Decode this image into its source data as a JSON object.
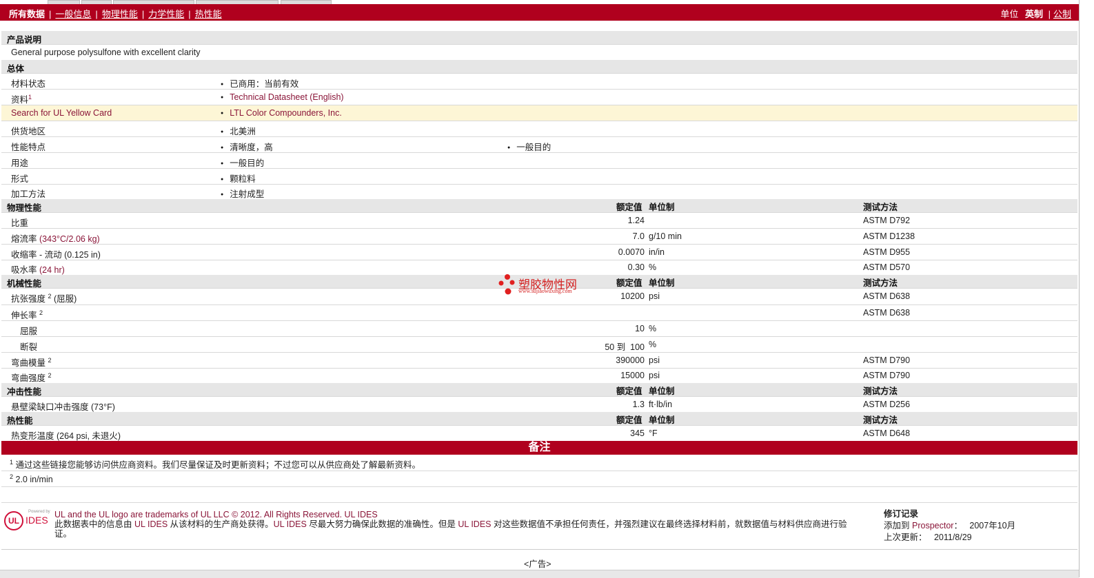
{
  "nav": {
    "tabs": [
      "所有数据",
      "一般信息",
      "物理性能",
      "力学性能",
      "热性能"
    ],
    "units_label": "单位",
    "unit_english": "英制",
    "unit_metric": "公制"
  },
  "product": {
    "header": "产品说明",
    "description": "General purpose polysulfone with excellent clarity"
  },
  "general": {
    "header": "总体",
    "rows": [
      {
        "label": "材料状态",
        "value": "已商用：当前有效"
      },
      {
        "label": "资料",
        "sup": "1",
        "value": "Technical Datasheet (English)"
      },
      {
        "label": "Search for UL Yellow Card",
        "value": "LTL Color Compounders, Inc."
      },
      {
        "label": "供货地区",
        "value": "北美洲"
      },
      {
        "label": "性能特点",
        "value": "清晰度，高",
        "value2": "一般目的"
      },
      {
        "label": "用途",
        "value": "一般目的"
      },
      {
        "label": "形式",
        "value": "颗粒料"
      },
      {
        "label": "加工方法",
        "value": "注射成型"
      }
    ]
  },
  "col_headers": {
    "rated": "额定值",
    "unit": "单位制",
    "method": "测试方法"
  },
  "physical": {
    "header": "物理性能",
    "rows": [
      {
        "label": "比重",
        "cond": "",
        "value": "1.24",
        "unit": "",
        "method": "ASTM D792"
      },
      {
        "label": "熔流率",
        "cond": "(343°C/2.06 kg)",
        "value": "7.0",
        "unit": "g/10 min",
        "method": "ASTM D1238"
      },
      {
        "label": "收缩率",
        "cond": "- 流动 (0.125 in)",
        "value": "0.0070",
        "unit": "in/in",
        "method": "ASTM D955"
      },
      {
        "label": "吸水率",
        "cond": "(24 hr)",
        "value": "0.30",
        "unit": "%",
        "method": "ASTM D570"
      }
    ]
  },
  "mechanical": {
    "header": "机械性能",
    "rows": [
      {
        "label": "抗张强度",
        "sup": "2",
        "cond": "(屈服)",
        "value": "10200",
        "unit": "psi",
        "method": "ASTM D638"
      },
      {
        "label": "伸长率",
        "sup": "2",
        "cond": "",
        "value": "",
        "unit": "",
        "method": "ASTM D638"
      },
      {
        "label": "屈服",
        "cond": "",
        "value": "10",
        "unit": "%",
        "method": "",
        "indent": true
      },
      {
        "label": "断裂",
        "cond": "",
        "value": "50 到  100",
        "unit": "%",
        "method": "",
        "indent": true
      },
      {
        "label": "弯曲模量",
        "sup": "2",
        "cond": "",
        "value": "390000",
        "unit": "psi",
        "method": "ASTM D790"
      },
      {
        "label": "弯曲强度",
        "sup": "2",
        "cond": "",
        "value": "15000",
        "unit": "psi",
        "method": "ASTM D790"
      }
    ]
  },
  "impact": {
    "header": "冲击性能",
    "rows": [
      {
        "label": "悬壁梁缺口冲击强度",
        "cond": "(73°F)",
        "value": "1.3",
        "unit": "ft·lb/in",
        "method": "ASTM D256"
      }
    ]
  },
  "thermal": {
    "header": "热性能",
    "rows": [
      {
        "label": "热变形温度",
        "cond": "(264 psi, 未退火)",
        "value": "345",
        "unit": "°F",
        "method": "ASTM D648"
      }
    ]
  },
  "watermark": {
    "name": "塑胶物性网",
    "url": "www.sujiaowuxing.com"
  },
  "notes": {
    "header": "备注",
    "items": [
      {
        "n": "1",
        "text": "通过这些链接您能够访问供应商资料。我们尽量保证及时更新资料；不过您可以从供应商处了解最新资料。"
      },
      {
        "n": "2",
        "text": "2.0 in/min"
      }
    ]
  },
  "footer": {
    "powered_by": "Powered by",
    "ides": "IDES",
    "trademark": "UL and the UL logo are trademarks of UL LLC © 2012. All Rights Reserved. UL IDES",
    "disclaimer_a": "此数据表中的信息由",
    "ul_ides": "UL IDES",
    "disclaimer_b": "从该材料的生产商处获得。",
    "disclaimer_c": "尽最大努力确保此数据的准确性。但是",
    "disclaimer_d": "对这些数据值不承担任何责任，并强烈建议在最终选择材料前，就数据值与材料供应商进行验",
    "disclaimer_e": "证。",
    "rev_title": "修订记录",
    "added_label": "添加到",
    "prospector": "Prospector",
    "colon": "：",
    "added_date": "2007年10月",
    "updated_label": "上次更新：",
    "updated_date": "2011/8/29",
    "ad": "<广告>"
  }
}
